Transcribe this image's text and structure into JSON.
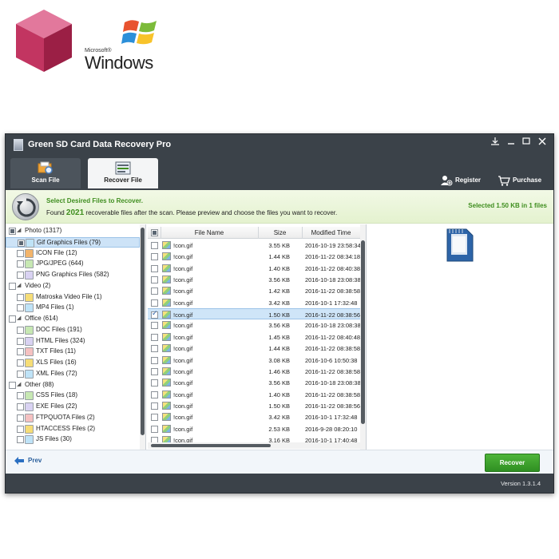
{
  "branding": {
    "ms_label": "Microsoft®",
    "windows_label": "Windows"
  },
  "window": {
    "title": "Green SD Card Data Recovery Pro",
    "controls": [
      "download-icon",
      "minimize-icon",
      "maximize-icon",
      "close-icon"
    ]
  },
  "tabs": [
    {
      "label": "Scan File",
      "icon": "scan-icon",
      "active": false
    },
    {
      "label": "Recover File",
      "icon": "recover-icon",
      "active": true
    }
  ],
  "header_actions": {
    "register": "Register",
    "purchase": "Purchase"
  },
  "banner": {
    "title": "Select Desired Files to Recover.",
    "found_prefix": "Found",
    "found_count": "2021",
    "found_suffix": "recoverable files after the scan. Please preview and choose the files you want to recover.",
    "selected": "Selected 1.50 KB in 1 files"
  },
  "tree": [
    {
      "label": "Photo (1317)",
      "icon": "",
      "state": "partial",
      "expanded": true
    },
    {
      "label": "Gif Graphics Files (79)",
      "icon": "gif-file-icon",
      "state": "partial",
      "selected": true
    },
    {
      "label": "ICON File (12)",
      "icon": "icon-file-icon",
      "state": "unchecked"
    },
    {
      "label": "JPG/JPEG (644)",
      "icon": "jpg-file-icon",
      "state": "unchecked"
    },
    {
      "label": "PNG Graphics Files (582)",
      "icon": "png-file-icon",
      "state": "unchecked"
    },
    {
      "label": "Video (2)",
      "icon": "",
      "state": "unchecked",
      "expanded": true
    },
    {
      "label": "Matroska Video File (1)",
      "icon": "mkv-file-icon",
      "state": "unchecked"
    },
    {
      "label": "MP4 Files (1)",
      "icon": "mp4-file-icon",
      "state": "unchecked"
    },
    {
      "label": "Office (614)",
      "icon": "",
      "state": "unchecked",
      "expanded": true
    },
    {
      "label": "DOC Files (191)",
      "icon": "doc-file-icon",
      "state": "unchecked"
    },
    {
      "label": "HTML Files (324)",
      "icon": "html-file-icon",
      "state": "unchecked"
    },
    {
      "label": "TXT Files (11)",
      "icon": "txt-file-icon",
      "state": "unchecked"
    },
    {
      "label": "XLS Files (16)",
      "icon": "xls-file-icon",
      "state": "unchecked"
    },
    {
      "label": "XML Files (72)",
      "icon": "xml-file-icon",
      "state": "unchecked"
    },
    {
      "label": "Other (88)",
      "icon": "",
      "state": "unchecked",
      "expanded": true
    },
    {
      "label": "CSS Files (18)",
      "icon": "css-file-icon",
      "state": "unchecked"
    },
    {
      "label": "EXE Files (22)",
      "icon": "exe-file-icon",
      "state": "unchecked"
    },
    {
      "label": "FTPQUOTA Files (2)",
      "icon": "ftpquota-file-icon",
      "state": "unchecked"
    },
    {
      "label": "HTACCESS Files (2)",
      "icon": "htaccess-file-icon",
      "state": "unchecked"
    },
    {
      "label": "JS Files (30)",
      "icon": "js-file-icon",
      "state": "unchecked"
    }
  ],
  "file_table": {
    "columns": [
      "File Name",
      "Size",
      "Modified Time"
    ],
    "rows": [
      {
        "name": "!con.gif",
        "size": "3.55 KB",
        "modified": "2016-10-19 23:58:34",
        "checked": false
      },
      {
        "name": "!con.gif",
        "size": "1.44 KB",
        "modified": "2016-11-22 08:34:18",
        "checked": false
      },
      {
        "name": "!con.gif",
        "size": "1.40 KB",
        "modified": "2016-11-22 08:40:38",
        "checked": false
      },
      {
        "name": "!con.gif",
        "size": "3.56 KB",
        "modified": "2016-10-18 23:08:38",
        "checked": false
      },
      {
        "name": "!con.gif",
        "size": "1.42 KB",
        "modified": "2016-11-22 08:38:58",
        "checked": false
      },
      {
        "name": "!con.gif",
        "size": "3.42 KB",
        "modified": "2016-10-1 17:32:48",
        "checked": false
      },
      {
        "name": "!con.gif",
        "size": "1.50 KB",
        "modified": "2016-11-22 08:38:56",
        "checked": true
      },
      {
        "name": "!con.gif",
        "size": "3.56 KB",
        "modified": "2016-10-18 23:08:38",
        "checked": false
      },
      {
        "name": "!con.gif",
        "size": "1.45 KB",
        "modified": "2016-11-22 08:40:48",
        "checked": false
      },
      {
        "name": "!con.gif",
        "size": "1.44 KB",
        "modified": "2016-11-22 08:38:58",
        "checked": false
      },
      {
        "name": "!con.gif",
        "size": "3.08 KB",
        "modified": "2016-10-6 10:50:38",
        "checked": false
      },
      {
        "name": "!con.gif",
        "size": "1.46 KB",
        "modified": "2016-11-22 08:38:58",
        "checked": false
      },
      {
        "name": "!con.gif",
        "size": "3.56 KB",
        "modified": "2016-10-18 23:08:38",
        "checked": false
      },
      {
        "name": "!con.gif",
        "size": "1.40 KB",
        "modified": "2016-11-22 08:38:58",
        "checked": false
      },
      {
        "name": "!con.gif",
        "size": "1.50 KB",
        "modified": "2016-11-22 08:38:56",
        "checked": false
      },
      {
        "name": "!con.gif",
        "size": "3.42 KB",
        "modified": "2016-10-1 17:32:48",
        "checked": false
      },
      {
        "name": "!con.gif",
        "size": "2.53 KB",
        "modified": "2016-9-28 08:20:10",
        "checked": false
      },
      {
        "name": "!con.gif",
        "size": "3.16 KB",
        "modified": "2016-10-1 17:40:48",
        "checked": false
      }
    ]
  },
  "preview": {
    "icon": "sd-card-icon"
  },
  "bottom": {
    "prev_label": "Prev",
    "recover_label": "Recover"
  },
  "status": {
    "version": "Version 1.3.1.4"
  },
  "colors": {
    "window_dark": "#3b4249",
    "accent_green": "#3f8e1f",
    "button_green": "#2f8f22",
    "selection_blue": "#cde3f7"
  }
}
